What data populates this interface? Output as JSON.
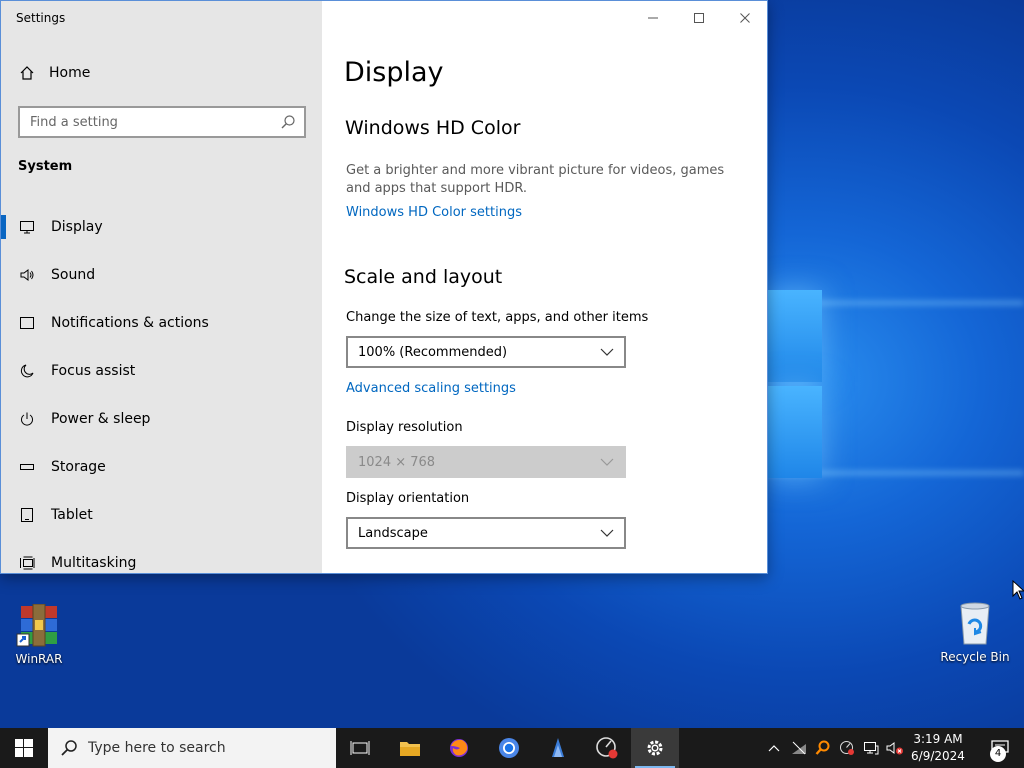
{
  "window": {
    "title": "Settings",
    "minimize_glyph": "—",
    "maximize_glyph": "☐",
    "close_glyph": "✕"
  },
  "sidebar": {
    "home_label": "Home",
    "search_placeholder": "Find a setting",
    "section": "System",
    "items": [
      {
        "label": "Display",
        "icon": "monitor-icon",
        "active": true
      },
      {
        "label": "Sound",
        "icon": "speaker-icon"
      },
      {
        "label": "Notifications & actions",
        "icon": "notification-icon"
      },
      {
        "label": "Focus assist",
        "icon": "moon-icon"
      },
      {
        "label": "Power & sleep",
        "icon": "power-icon"
      },
      {
        "label": "Storage",
        "icon": "storage-icon"
      },
      {
        "label": "Tablet",
        "icon": "tablet-icon"
      },
      {
        "label": "Multitasking",
        "icon": "multitasking-icon"
      }
    ]
  },
  "main": {
    "title": "Display",
    "hd_color": {
      "heading": "Windows HD Color",
      "description": "Get a brighter and more vibrant picture for videos, games and apps that support HDR.",
      "link": "Windows HD Color settings"
    },
    "scale": {
      "heading": "Scale and layout",
      "size_label": "Change the size of text, apps, and other items",
      "size_value": "100% (Recommended)",
      "advanced_link": "Advanced scaling settings",
      "resolution_label": "Display resolution",
      "resolution_value": "1024 × 768",
      "orientation_label": "Display orientation",
      "orientation_value": "Landscape"
    }
  },
  "desktop": {
    "icons": [
      {
        "label": "WinRAR",
        "icon": "winrar-icon"
      },
      {
        "label": "Recycle Bin",
        "icon": "recycle-bin-icon"
      }
    ]
  },
  "taskbar": {
    "search_placeholder": "Type here to search",
    "time": "3:19 AM",
    "date": "6/9/2024",
    "notification_count": "4"
  },
  "colors": {
    "accent": "#0067c0",
    "sidebar_bg": "#e6e6e6",
    "taskbar_bg": "#1a1a1a"
  }
}
